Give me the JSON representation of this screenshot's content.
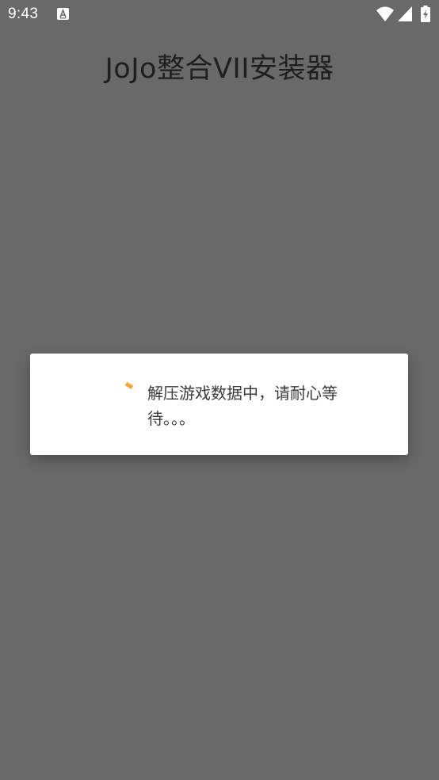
{
  "status_bar": {
    "time": "9:43",
    "icons": [
      "text-a-notification-icon",
      "wifi-icon",
      "cell-signal-icon",
      "battery-charging-icon"
    ]
  },
  "header": {
    "title": "JoJo整合VII安装器"
  },
  "dialog": {
    "message": "解压游戏数据中，请耐心等待。。。",
    "spinner_icon": "progress-spinner-icon",
    "spinner_color": "#f5a73b"
  },
  "colors": {
    "background": "#696969",
    "dialog_background": "#ffffff",
    "title_text": "#1f1f1f",
    "message_text": "#3a3a3a"
  }
}
